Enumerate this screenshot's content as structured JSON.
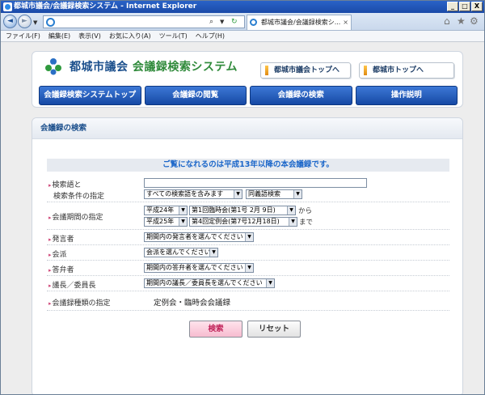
{
  "window": {
    "title": "都城市議会/会議録検索システム - Internet Explorer",
    "minimize": "_",
    "maximize": "□",
    "close": "X"
  },
  "browser": {
    "back_glyph": "◄",
    "forward_glyph": "►",
    "dropdown_glyph": "▼",
    "search_glyph": "⌕",
    "refresh_glyph": "↻",
    "tab_title": "都城市議会/会議録検索シ...",
    "tab_close": "×",
    "home_glyph": "⌂",
    "favorites_glyph": "★",
    "tools_glyph": "⚙",
    "menu": [
      "ファイル(F)",
      "編集(E)",
      "表示(V)",
      "お気に入り(A)",
      "ツール(T)",
      "ヘルプ(H)"
    ]
  },
  "header": {
    "site_title_main": "都城市議会",
    "site_title_sub": "会議録検索システム",
    "council_top_link": "都城市議会トップへ",
    "city_top_link": "都城市トップへ",
    "nav_tabs": [
      "会議録検索システムトップ",
      "会議録の閲覧",
      "会議録の検索",
      "操作説明"
    ]
  },
  "panel": {
    "heading": "会議録の検索",
    "notice": "ご覧になれるのは平成13年以降の本会議録です。",
    "bullet": "▸",
    "arrow": "▼",
    "keyword_label_1": "検索語と",
    "keyword_label_2": "検索条件の指定",
    "keyword_value": "",
    "keyword_condition": "すべての検索語を含みます",
    "synonym": "同義語検索",
    "period_label": "会議期間の指定",
    "from_year": "平成24年",
    "from_session": "第1回臨時会(第1号 2月 9日)",
    "from_suffix": "から",
    "to_year": "平成25年",
    "to_session": "第4回定例会(第7号12月18日)",
    "to_suffix": "まで",
    "speaker_label": "発言者",
    "speaker_value": "期間内の発言者を選んでください",
    "faction_label": "会派",
    "faction_value": "会派を選んでください",
    "answerer_label": "答弁者",
    "answerer_value": "期間内の答弁者を選んでください",
    "chair_label": "議長／委員長",
    "chair_value": "期間内の議長／委員長を選んでください",
    "kind_label": "会議録種類の指定",
    "kind_value": "定例会・臨時会会議録",
    "search_button": "検索",
    "reset_button": "リセット"
  },
  "colors": {
    "title_blue": "#1b4f8c",
    "tab_blue": "#1649a4",
    "notice_blue": "#1b66c9",
    "search_pink": "#c0245a"
  }
}
